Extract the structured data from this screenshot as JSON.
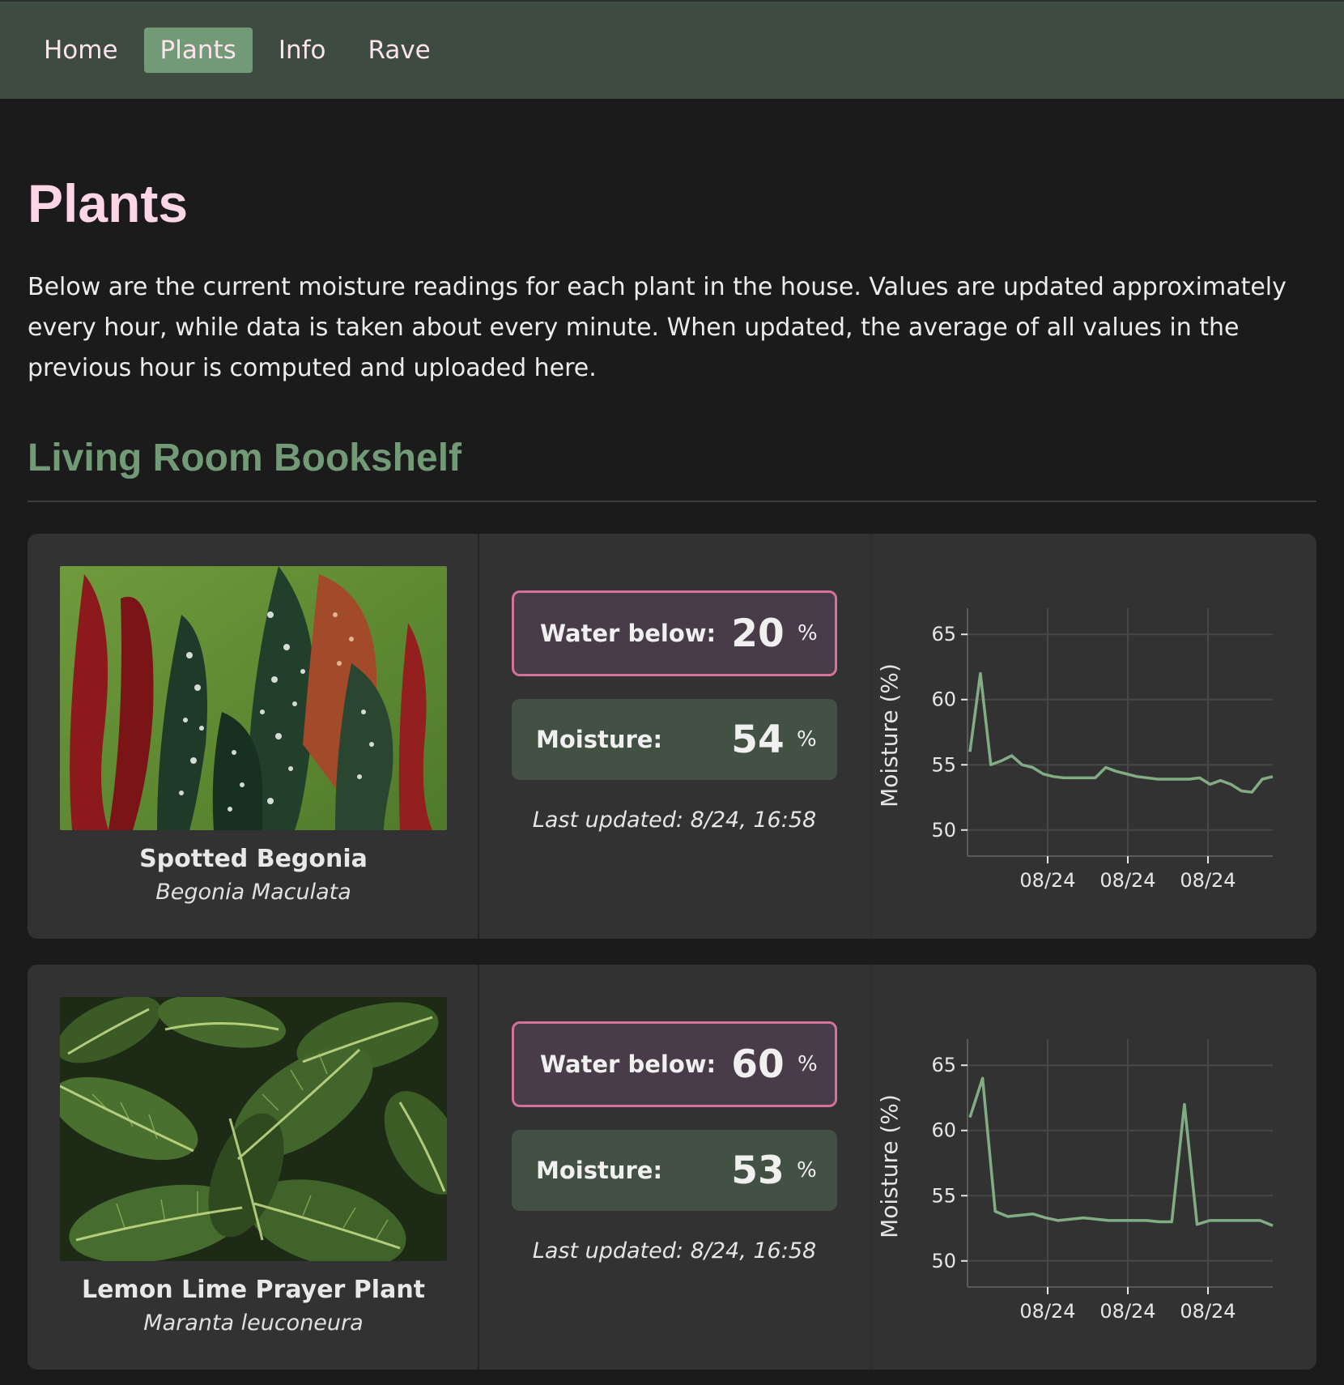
{
  "nav": {
    "items": [
      {
        "label": "Home",
        "active": false
      },
      {
        "label": "Plants",
        "active": true
      },
      {
        "label": "Info",
        "active": false
      },
      {
        "label": "Rave",
        "active": false
      }
    ]
  },
  "page": {
    "title": "Plants",
    "intro": "Below are the current moisture readings for each plant in the house. Values are updated approximately every hour, while data is taken about every minute. When updated, the average of all values in the previous hour is computed and uploaded here."
  },
  "section": {
    "title": "Living Room Bookshelf"
  },
  "colors": {
    "nav_bg": "#3e4b40",
    "nav_active": "#739a76",
    "accent_pink": "#d5719d",
    "accent_green": "#739a76",
    "title_pink": "#fcd6e6",
    "line": "#82ad84"
  },
  "plants": [
    {
      "name": "Spotted Begonia",
      "scientific": "Begonia Maculata",
      "photo_icon": "begonia-photo",
      "water_below_label": "Water below:",
      "water_below": "20",
      "moisture_label": "Moisture:",
      "moisture": "54",
      "unit": "%",
      "last_updated": "Last updated: 8/24, 16:58",
      "chart_data": {
        "type": "line",
        "xlabel": "",
        "ylabel": "Moisture (%)",
        "ylim": [
          48,
          67
        ],
        "yticks": [
          50,
          55,
          60,
          65
        ],
        "xticks": [
          "08/24",
          "08/24",
          "08/24"
        ],
        "grid": true,
        "series": [
          {
            "values": [
              56,
              62,
              55,
              55.3,
              55.7,
              55,
              54.8,
              54.3,
              54.1,
              54,
              54,
              54,
              54,
              54.8,
              54.5,
              54.3,
              54.1,
              54,
              53.9,
              53.9,
              53.9,
              53.9,
              54,
              53.5,
              53.8,
              53.5,
              53,
              52.9,
              53.9,
              54.1
            ]
          }
        ]
      }
    },
    {
      "name": "Lemon Lime Prayer Plant",
      "scientific": "Maranta leuconeura",
      "photo_icon": "prayer-plant-photo",
      "water_below_label": "Water below:",
      "water_below": "60",
      "moisture_label": "Moisture:",
      "moisture": "53",
      "unit": "%",
      "last_updated": "Last updated: 8/24, 16:58",
      "chart_data": {
        "type": "line",
        "xlabel": "",
        "ylabel": "Moisture (%)",
        "ylim": [
          48,
          67
        ],
        "yticks": [
          50,
          55,
          60,
          65
        ],
        "xticks": [
          "08/24",
          "08/24",
          "08/24"
        ],
        "grid": true,
        "series": [
          {
            "values": [
              61,
              64,
              53.8,
              53.4,
              53.5,
              53.6,
              53.3,
              53.1,
              53.2,
              53.3,
              53.2,
              53.1,
              53.1,
              53.1,
              53.1,
              53,
              53,
              62,
              52.8,
              53.1,
              53.1,
              53.1,
              53.1,
              53.1,
              52.7
            ]
          }
        ]
      }
    }
  ]
}
